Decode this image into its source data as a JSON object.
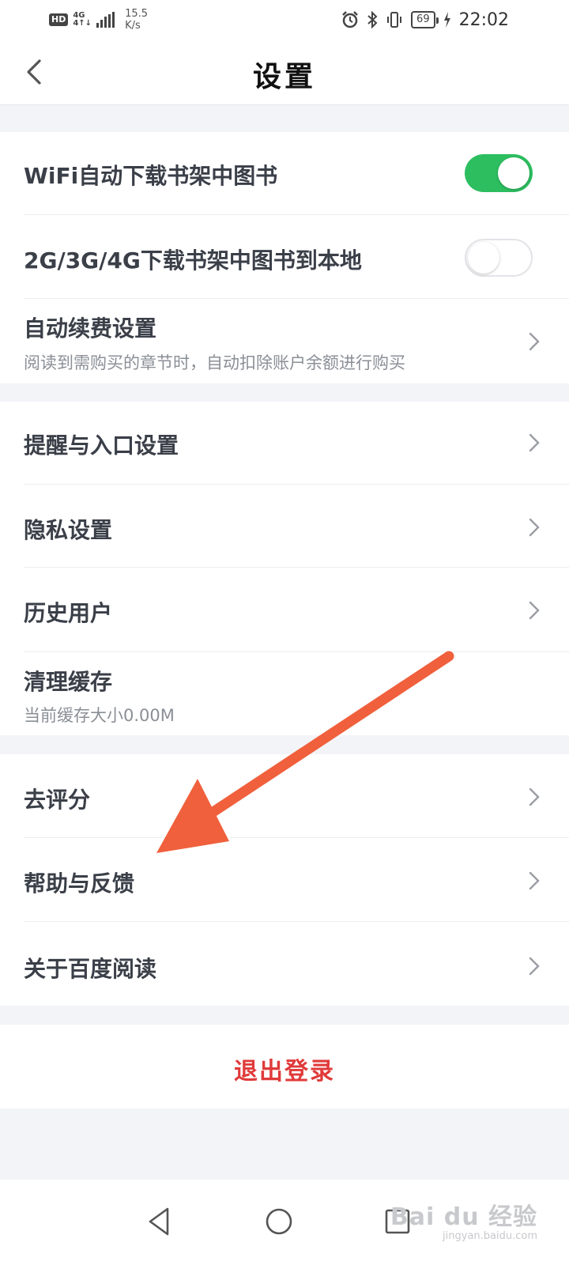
{
  "status_bar": {
    "hd": "HD",
    "network": "4G",
    "network_sub": "4↑↓",
    "speed_value": "15.5",
    "speed_unit": "K/s",
    "battery": "69",
    "time": "22:02",
    "icons": [
      "alarm-icon",
      "bluetooth-icon",
      "vibrate-icon",
      "battery-icon",
      "charging-icon"
    ]
  },
  "header": {
    "title": "设置",
    "back_icon": "chevron-left-icon"
  },
  "groups": {
    "download": {
      "wifi_label": "WiFi自动下载书架中图书",
      "wifi_on": true,
      "mobile_label": "2G/3G/4G下载书架中图书到本地",
      "mobile_on": false,
      "autopay_label": "自动续费设置",
      "autopay_sub": "阅读到需购买的章节时，自动扣除账户余额进行购买"
    },
    "general": {
      "reminder_label": "提醒与入口设置",
      "privacy_label": "隐私设置",
      "history_label": "历史用户",
      "cache_label": "清理缓存",
      "cache_sub": "当前缓存大小0.00M"
    },
    "about": {
      "rate_label": "去评分",
      "help_label": "帮助与反馈",
      "about_label": "关于百度阅读"
    }
  },
  "logout": {
    "label": "退出登录"
  },
  "colors": {
    "toggle_on": "#2dbe60",
    "logout": "#e03a3a",
    "arrow": "#f0603c"
  },
  "watermark": {
    "main": "Bai du 经验",
    "sub": "jingyan.baidu.com"
  }
}
